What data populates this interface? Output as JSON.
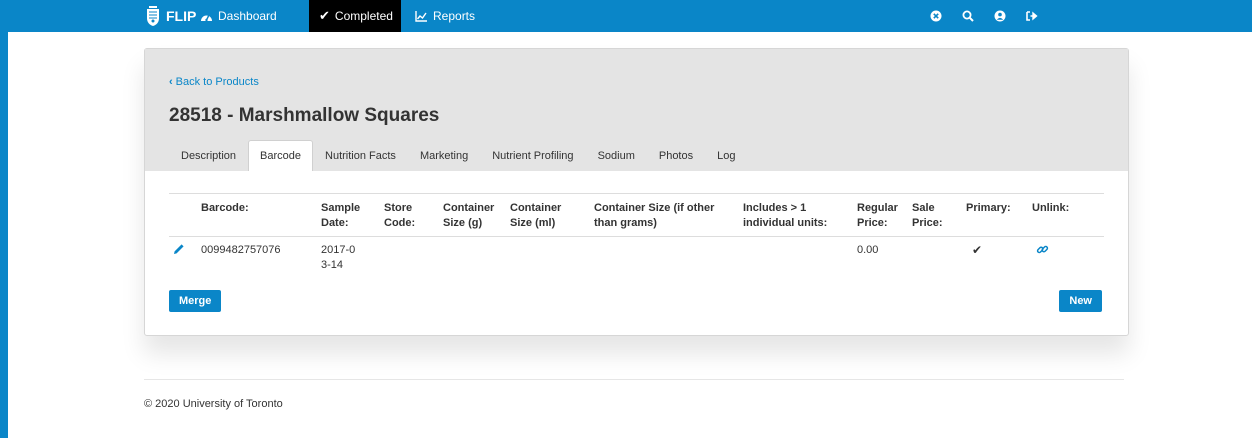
{
  "colors": {
    "nav_bg": "#0a86c8",
    "accent": "#0a86c8",
    "active_nav": "#000000"
  },
  "navbar": {
    "brand": "FLIP",
    "items": [
      {
        "label": "Dashboard",
        "icon": "dashboard-icon"
      },
      {
        "label": "Completed",
        "icon": "checkmark-icon",
        "active": true
      },
      {
        "label": "Reports",
        "icon": "line-chart-icon"
      }
    ],
    "icons": [
      "close-circle-icon",
      "search-icon",
      "user-icon",
      "sign-out-icon"
    ]
  },
  "product": {
    "back_label": "Back to Products",
    "title": "28518 - Marshmallow Squares",
    "tabs": [
      "Description",
      "Barcode",
      "Nutrition Facts",
      "Marketing",
      "Nutrient Profiling",
      "Sodium",
      "Photos",
      "Log"
    ],
    "active_tab": "Barcode"
  },
  "barcode_table": {
    "headers": {
      "barcode": "Barcode:",
      "sample_date": "Sample Date:",
      "store_code": "Store Code:",
      "container_g": "Container Size (g)",
      "container_ml": "Container Size (ml)",
      "container_other": "Container Size (if other than grams)",
      "includes_units": "Includes > 1 individual units:",
      "regular_price": "Regular Price:",
      "sale_price": "Sale Price:",
      "primary": "Primary:",
      "unlink": "Unlink:"
    },
    "rows": [
      {
        "barcode": "0099482757076",
        "sample_date": "2017-03-14",
        "store_code": "",
        "container_g": "",
        "container_ml": "",
        "container_other": "",
        "includes_units": "",
        "regular_price": "0.00",
        "sale_price": "",
        "primary": "✔",
        "unlink": "link-icon"
      }
    ]
  },
  "buttons": {
    "merge": "Merge",
    "new": "New"
  },
  "footer": {
    "text": "© 2020 University of Toronto"
  }
}
